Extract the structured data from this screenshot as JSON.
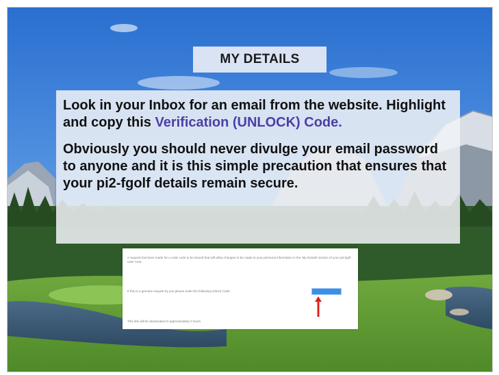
{
  "slide": {
    "title": "MY DETAILS",
    "paragraph1_before": "Look in your Inbox for an email from the website. Highlight and copy this ",
    "paragraph1_highlight": "Verification (UNLOCK) Code.",
    "paragraph2": "Obviously you should never divulge your email password to anyone and it is this simple precaution that ensures that your pi2-fgolf details remain secure."
  },
  "email": {
    "line1": "A request has been made for a code code to be issued that will allow changes to be made to your personal information in the 'My Details' section of your pi2-fgolf User Area.",
    "line2": "If this is a genuine request by you please enter the following Unlock Code:",
    "line3": "This link will be deactivated in approximately 2 hours."
  },
  "colors": {
    "highlight_text": "#4a3fa6",
    "code_selection": "#3d8fe6",
    "arrow": "#e0201a"
  }
}
